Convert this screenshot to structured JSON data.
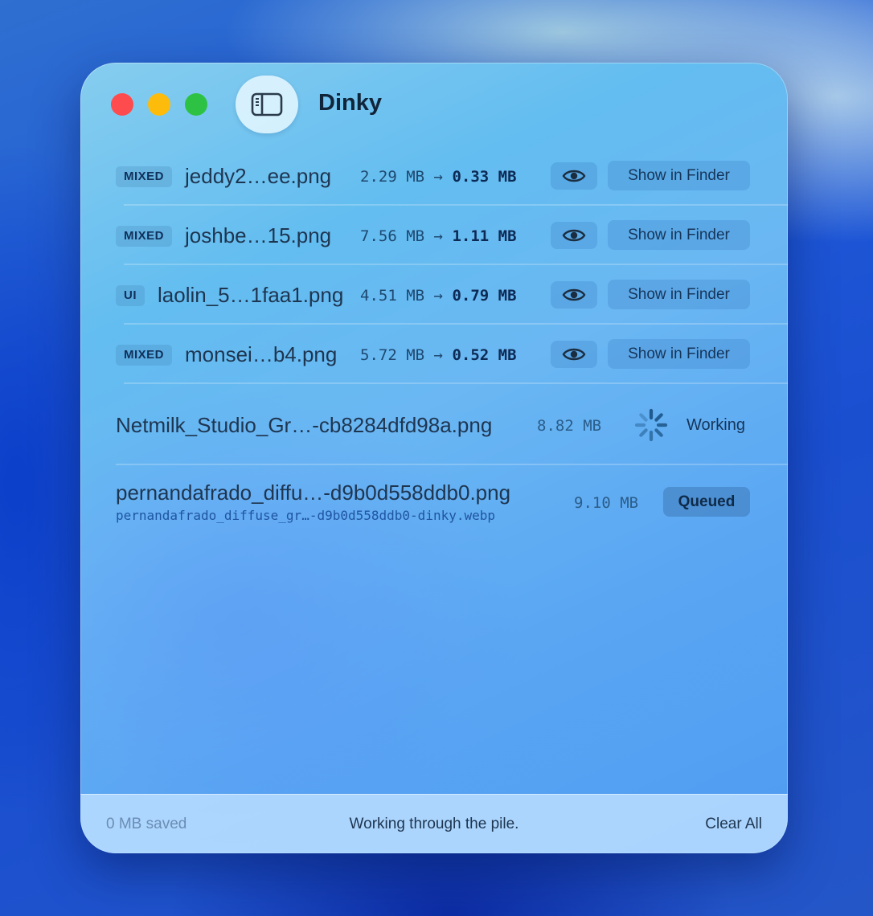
{
  "window": {
    "title": "Dinky",
    "traffic_lights": [
      "close",
      "minimize",
      "zoom"
    ],
    "sidebar_toggle_icon": "sidebar-icon"
  },
  "rows": [
    {
      "tag": "MIXED",
      "name": "jeddy2…ee.png",
      "original": "2.29 MB",
      "arrow": "→",
      "compressed": "0.33 MB",
      "preview_icon": "eye-icon",
      "finder_label": "Show in Finder"
    },
    {
      "tag": "MIXED",
      "name": "joshbe…15.png",
      "original": "7.56 MB",
      "arrow": "→",
      "compressed": "1.11 MB",
      "preview_icon": "eye-icon",
      "finder_label": "Show in Finder"
    },
    {
      "tag": "UI",
      "name": "laolin_5…1faa1.png",
      "original": "4.51 MB",
      "arrow": "→",
      "compressed": "0.79 MB",
      "preview_icon": "eye-icon",
      "finder_label": "Show in Finder"
    },
    {
      "tag": "MIXED",
      "name": "monsei…b4.png",
      "original": "5.72 MB",
      "arrow": "→",
      "compressed": "0.52 MB",
      "preview_icon": "eye-icon",
      "finder_label": "Show in Finder"
    }
  ],
  "working": {
    "name": "Netmilk_Studio_Gr…-cb8284dfd98a.png",
    "size": "8.82 MB",
    "status": "Working"
  },
  "queued": {
    "name": "pernandafrado_diffu…-d9b0d558ddb0.png",
    "output": "pernandafrado_diffuse_gr…-d9b0d558ddb0-dinky.webp",
    "size": "9.10 MB",
    "status": "Queued"
  },
  "footer": {
    "saved": "0 MB saved",
    "status": "Working through the pile.",
    "clear_label": "Clear All"
  },
  "colors": {
    "close": "#fe4b4d",
    "minimize": "#fdbc0c",
    "zoom": "#2ec244",
    "accent_text": "#10243a"
  }
}
